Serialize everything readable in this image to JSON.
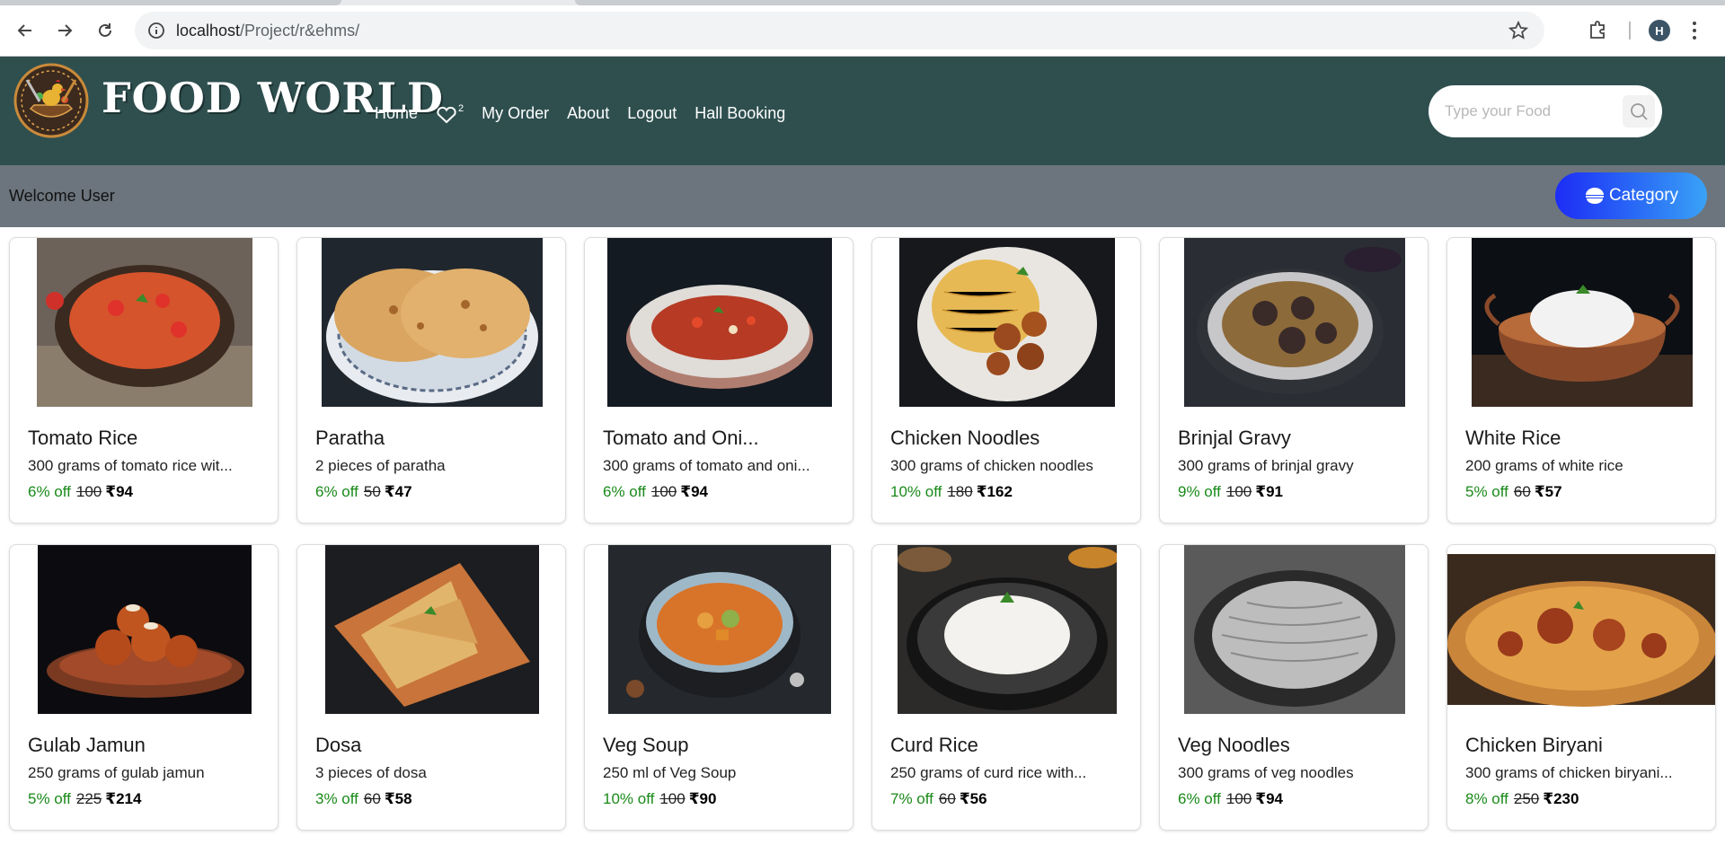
{
  "browser": {
    "url_host": "localhost",
    "url_path": "/Project/r&ehms/",
    "profile_initial": "H"
  },
  "header": {
    "brand": "FOOD WORLD",
    "nav": {
      "home": "Home",
      "favorites_count": "2",
      "my_order": "My Order",
      "about": "About",
      "logout": "Logout",
      "hall_booking": "Hall Booking"
    },
    "search_placeholder": "Type your Food"
  },
  "welcome": {
    "text": "Welcome User",
    "category_label": "Category"
  },
  "colors": {
    "header_bg": "#2f4f4f",
    "welcome_bg": "#6c757d",
    "discount_green": "#1a8a1a",
    "category_gradient_start": "#1d2df5",
    "category_gradient_end": "#3aa2f7"
  },
  "items": [
    {
      "name": "Tomato Rice",
      "desc": "300 grams of tomato rice wit...",
      "off": "6% off",
      "mrp": "100",
      "price": "₹94"
    },
    {
      "name": "Paratha",
      "desc": "2 pieces of paratha",
      "off": "6% off",
      "mrp": "50",
      "price": "₹47"
    },
    {
      "name": "Tomato and Oni...",
      "desc": "300 grams of tomato and oni...",
      "off": "6% off",
      "mrp": "100",
      "price": "₹94"
    },
    {
      "name": "Chicken Noodles",
      "desc": "300 grams of chicken noodles",
      "off": "10% off",
      "mrp": "180",
      "price": "₹162"
    },
    {
      "name": "Brinjal Gravy",
      "desc": "300 grams of brinjal gravy",
      "off": "9% off",
      "mrp": "100",
      "price": "₹91"
    },
    {
      "name": "White Rice",
      "desc": "200 grams of white rice",
      "off": "5% off",
      "mrp": "60",
      "price": "₹57"
    },
    {
      "name": "Gulab Jamun",
      "desc": "250 grams of gulab jamun",
      "off": "5% off",
      "mrp": "225",
      "price": "₹214"
    },
    {
      "name": "Dosa",
      "desc": "3 pieces of dosa",
      "off": "3% off",
      "mrp": "60",
      "price": "₹58"
    },
    {
      "name": "Veg Soup",
      "desc": "250 ml of Veg Soup",
      "off": "10% off",
      "mrp": "100",
      "price": "₹90"
    },
    {
      "name": "Curd Rice",
      "desc": "250 grams of curd rice with...",
      "off": "7% off",
      "mrp": "60",
      "price": "₹56"
    },
    {
      "name": "Veg Noodles",
      "desc": "300 grams of veg noodles",
      "off": "6% off",
      "mrp": "100",
      "price": "₹94"
    },
    {
      "name": "Chicken Biryani",
      "desc": "300 grams of chicken biryani...",
      "off": "8% off",
      "mrp": "250",
      "price": "₹230"
    }
  ]
}
